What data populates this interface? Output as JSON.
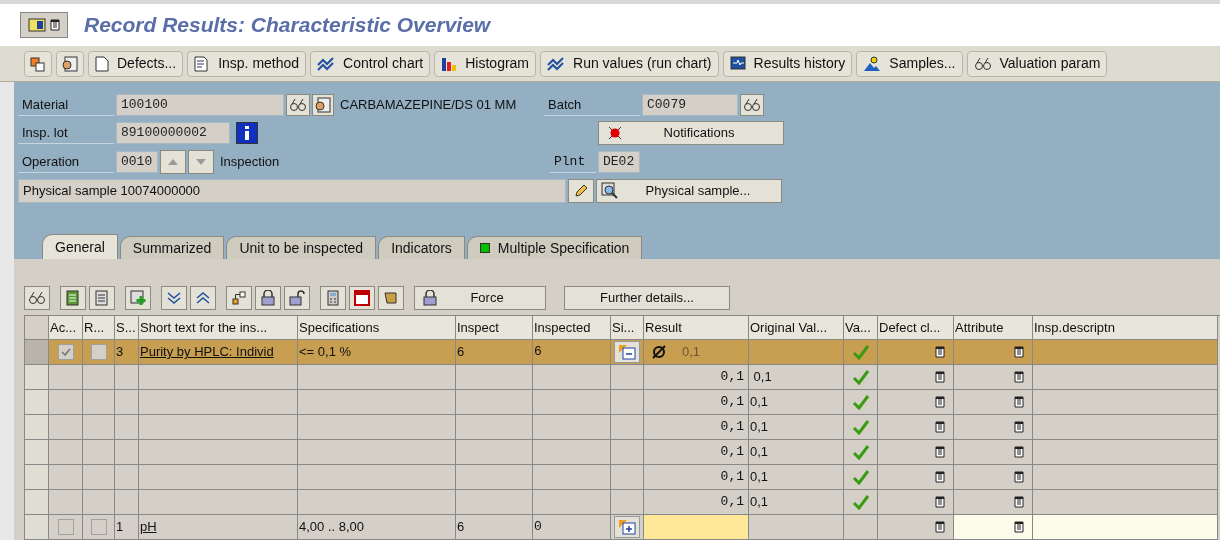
{
  "window": {
    "title": "Record Results: Characteristic Overview"
  },
  "toolbar": [
    {
      "kind": "icon"
    },
    {
      "kind": "icon"
    },
    {
      "kind": "text",
      "label": "Defects..."
    },
    {
      "kind": "text",
      "label": "Insp. method"
    },
    {
      "kind": "text",
      "label": "Control chart"
    },
    {
      "kind": "text",
      "label": "Histogram"
    },
    {
      "kind": "text",
      "label": "Run values (run chart)"
    },
    {
      "kind": "text",
      "label": "Results history"
    },
    {
      "kind": "text",
      "label": "Samples..."
    },
    {
      "kind": "text",
      "label": "Valuation param"
    }
  ],
  "header": {
    "material_label": "Material",
    "material": "100100",
    "material_text": "CARBAMAZEPINE/DS 01  MM",
    "batch_label": "Batch",
    "batch": "C0079",
    "lot_label": "Insp. lot",
    "lot": "89100000002",
    "notifications": "Notifications",
    "operation_label": "Operation",
    "operation": "0010",
    "operation_text": "Inspection",
    "plant_label": "Plnt",
    "plant": "DE02",
    "physical_sample_text": "Physical sample 10074000000",
    "physical_sample_button": "Physical sample..."
  },
  "tabs": [
    {
      "label": "General",
      "selected": true
    },
    {
      "label": "Summarized",
      "selected": false
    },
    {
      "label": "Unit to be inspected",
      "selected": false
    },
    {
      "label": "Indicators",
      "selected": false
    },
    {
      "label": "Multiple Specification",
      "selected": false,
      "status_light": true
    }
  ],
  "table_toolbar": {
    "force": "Force",
    "further": "Further details..."
  },
  "table": {
    "columns": [
      "Ac...",
      "R...",
      "S...",
      "Short text for the ins...",
      "Specifications",
      "Inspect",
      "Inspected",
      "Si...",
      "Result",
      "Original Val...",
      "Va...",
      "Defect cl...",
      "Attribute",
      "Insp.descriptn"
    ],
    "rows": [
      {
        "kind": "characteristic",
        "selected": true,
        "active": true,
        "r": false,
        "s": "3",
        "short_text": "Purity by HPLC: Individ",
        "spec": "<=  0,1  %",
        "inspect": "6",
        "inspected": "6",
        "expanded": true,
        "result": "0,1",
        "valid": true,
        "editable": false
      },
      {
        "kind": "value",
        "result": "0,1",
        "original": " 0,1",
        "valid": true
      },
      {
        "kind": "value",
        "result": "0,1",
        "original": "0,1",
        "valid": true
      },
      {
        "kind": "value",
        "result": "0,1",
        "original": "0,1",
        "valid": true
      },
      {
        "kind": "value",
        "result": "0,1",
        "original": "0,1",
        "valid": true
      },
      {
        "kind": "value",
        "result": "0,1",
        "original": "0,1",
        "valid": true
      },
      {
        "kind": "value",
        "result": "0,1",
        "original": "0,1",
        "valid": true
      },
      {
        "kind": "characteristic",
        "selected": false,
        "active": false,
        "r": false,
        "s": "1",
        "short_text": "pH",
        "spec": "4,00 .. 8,00",
        "inspect": "6",
        "inspected": "0",
        "expanded": false,
        "result": "",
        "valid": false,
        "editable": true
      }
    ]
  }
}
